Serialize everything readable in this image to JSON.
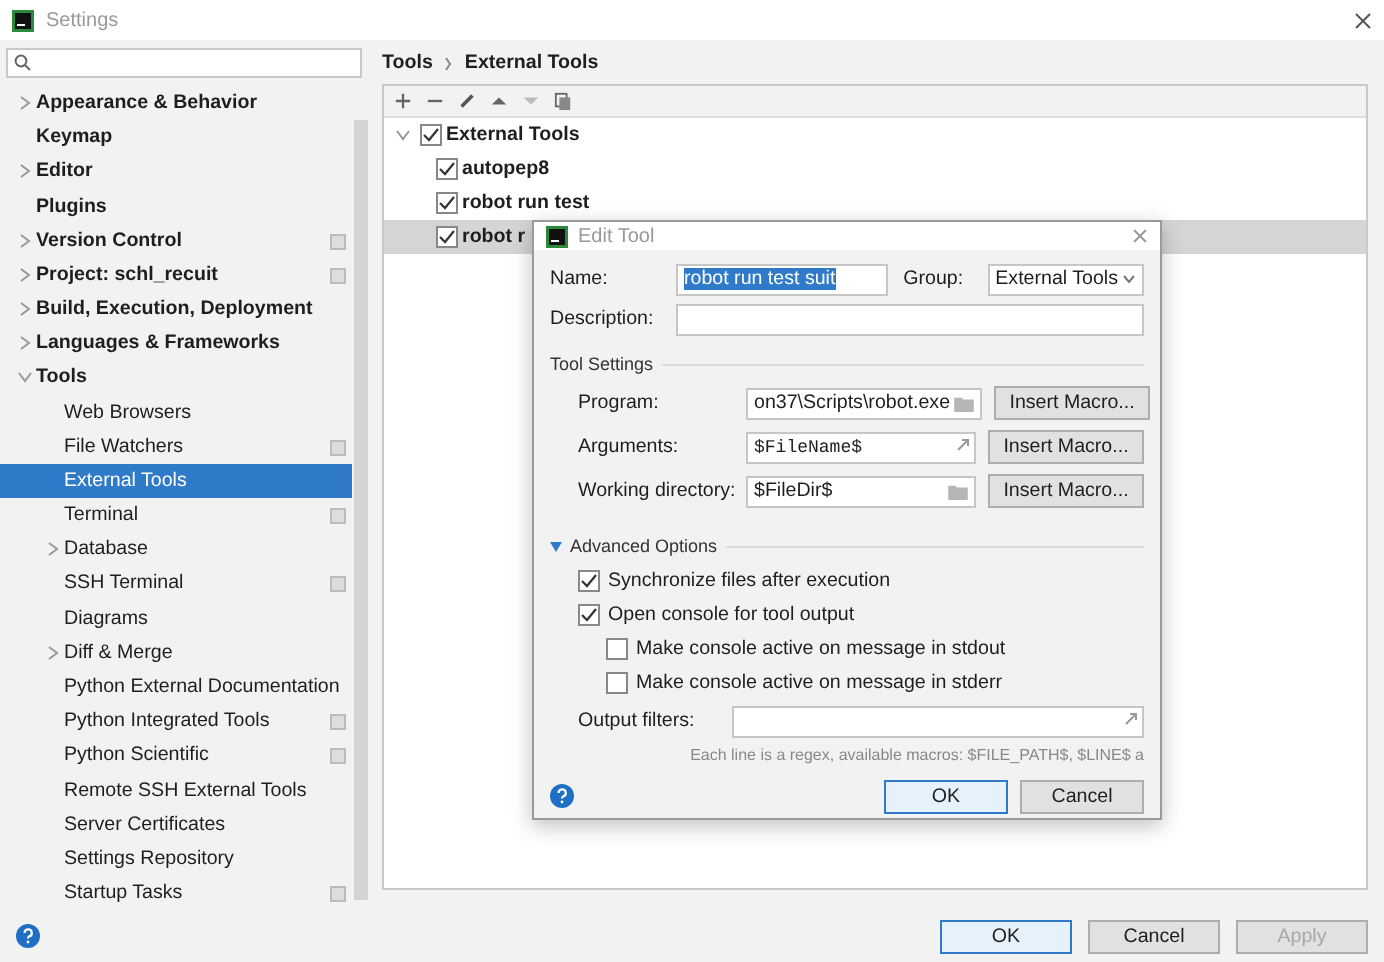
{
  "window": {
    "title": "Settings"
  },
  "sidebar": {
    "items": [
      {
        "label": "Appearance & Behavior",
        "expandable": true,
        "selected": false,
        "scoped": false
      },
      {
        "label": "Keymap",
        "expandable": false,
        "selected": false,
        "scoped": false
      },
      {
        "label": "Editor",
        "expandable": true,
        "selected": false,
        "scoped": false
      },
      {
        "label": "Plugins",
        "expandable": false,
        "selected": false,
        "scoped": false
      },
      {
        "label": "Version Control",
        "expandable": true,
        "selected": false,
        "scoped": true
      },
      {
        "label": "Project: schl_recuit",
        "expandable": true,
        "selected": false,
        "scoped": true
      },
      {
        "label": "Build, Execution, Deployment",
        "expandable": true,
        "selected": false,
        "scoped": false
      },
      {
        "label": "Languages & Frameworks",
        "expandable": true,
        "selected": false,
        "scoped": false
      },
      {
        "label": "Tools",
        "expandable": true,
        "expanded": true,
        "selected": false,
        "scoped": false,
        "children": [
          {
            "label": "Web Browsers",
            "expandable": false,
            "selected": false,
            "scoped": false
          },
          {
            "label": "File Watchers",
            "expandable": false,
            "selected": false,
            "scoped": true
          },
          {
            "label": "External Tools",
            "expandable": false,
            "selected": true,
            "scoped": false
          },
          {
            "label": "Terminal",
            "expandable": false,
            "selected": false,
            "scoped": true
          },
          {
            "label": "Database",
            "expandable": true,
            "selected": false,
            "scoped": false
          },
          {
            "label": "SSH Terminal",
            "expandable": false,
            "selected": false,
            "scoped": true
          },
          {
            "label": "Diagrams",
            "expandable": false,
            "selected": false,
            "scoped": false
          },
          {
            "label": "Diff & Merge",
            "expandable": true,
            "selected": false,
            "scoped": false
          },
          {
            "label": "Python External Documentation",
            "expandable": false,
            "selected": false,
            "scoped": false
          },
          {
            "label": "Python Integrated Tools",
            "expandable": false,
            "selected": false,
            "scoped": true
          },
          {
            "label": "Python Scientific",
            "expandable": false,
            "selected": false,
            "scoped": true
          },
          {
            "label": "Remote SSH External Tools",
            "expandable": false,
            "selected": false,
            "scoped": false
          },
          {
            "label": "Server Certificates",
            "expandable": false,
            "selected": false,
            "scoped": false
          },
          {
            "label": "Settings Repository",
            "expandable": false,
            "selected": false,
            "scoped": false
          },
          {
            "label": "Startup Tasks",
            "expandable": false,
            "selected": false,
            "scoped": true
          }
        ]
      }
    ]
  },
  "breadcrumb": [
    "Tools",
    "External Tools"
  ],
  "tools_tree": [
    {
      "label": "External Tools",
      "checked": true,
      "expanded": true,
      "selected": false,
      "children": [
        {
          "label": "autopep8",
          "checked": true,
          "selected": false
        },
        {
          "label": "robot run test",
          "checked": true,
          "selected": false
        },
        {
          "label": "robot r",
          "checked": true,
          "selected": true
        }
      ]
    }
  ],
  "dialog": {
    "title": "Edit Tool",
    "name": {
      "label": "Name:",
      "value": "robot run test suit"
    },
    "group": {
      "label": "Group:",
      "value": "External Tools"
    },
    "description": {
      "label": "Description:"
    },
    "tool_settings": {
      "title": "Tool Settings",
      "fields": [
        {
          "label": "Program:",
          "value": "on37\\Scripts\\robot.exe",
          "kind": "folder",
          "button": "Insert Macro..."
        },
        {
          "label": "Arguments:",
          "value": "$FileName$",
          "kind": "expand",
          "button": "Insert Macro..."
        },
        {
          "label": "Working directory:",
          "value": "$FileDir$",
          "kind": "folder",
          "button": "Insert Macro..."
        }
      ]
    },
    "advanced": {
      "title": "Advanced Options",
      "expanded": true,
      "options": [
        {
          "label": "Synchronize files after execution",
          "checked": true
        },
        {
          "label": "Open console for tool output",
          "checked": true,
          "children": [
            {
              "label": "Make console active on message in stdout",
              "checked": false
            },
            {
              "label": "Make console active on message in stderr",
              "checked": false
            }
          ]
        }
      ],
      "output_filters": {
        "label": "Output filters:"
      },
      "hint": "Each line is a regex, available macros: $FILE_PATH$, $LINE$ a"
    },
    "buttons": [
      {
        "label": "OK",
        "default": true
      },
      {
        "label": "Cancel",
        "default": false
      }
    ]
  },
  "footer_buttons": [
    {
      "label": "OK",
      "default": true,
      "disabled": false
    },
    {
      "label": "Cancel",
      "default": false,
      "disabled": false
    },
    {
      "label": "Apply",
      "default": false,
      "disabled": true
    }
  ]
}
